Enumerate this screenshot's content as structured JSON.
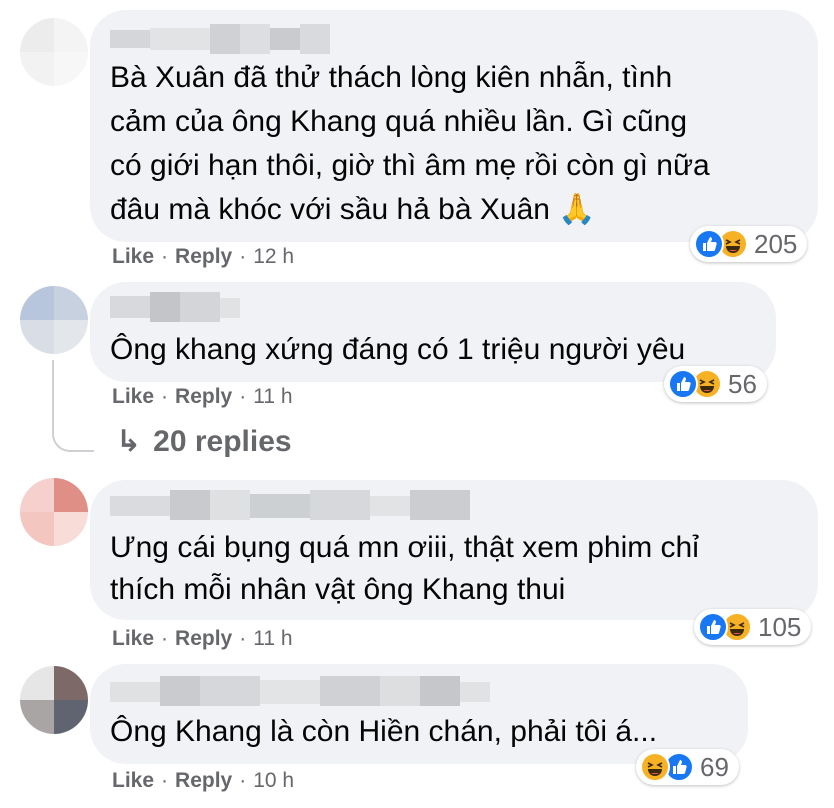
{
  "colors": {
    "bubble": "#f0f2f5",
    "meta_text": "#65676b",
    "like_blue": "#1877f2",
    "haha_yellow": "#f7b125"
  },
  "comments": [
    {
      "text_lines": [
        "Bà Xuân đã thử thách lòng kiên nhẫn, tình",
        "cảm của ông Khang quá nhiều lần. Gì cũng",
        "có giới hạn thôi, giờ thì âm mẹ rồi còn gì nữa",
        "đâu mà khóc với sầu hả bà Xuân 🙏"
      ],
      "like": "Like",
      "reply": "Reply",
      "time": "12 h",
      "reaction_icons": [
        "like-icon",
        "haha-icon"
      ],
      "reaction_count": "205"
    },
    {
      "text_lines": [
        "Ông khang xứng đáng có 1 triệu người yêu"
      ],
      "like": "Like",
      "reply": "Reply",
      "time": "11 h",
      "reaction_icons": [
        "like-icon",
        "haha-icon"
      ],
      "reaction_count": "56",
      "replies_label": "20 replies"
    },
    {
      "text_lines": [
        "Ưng cái bụng quá mn ơiii, thật xem phim chỉ",
        "thích mỗi nhân vật ông Khang thui"
      ],
      "like": "Like",
      "reply": "Reply",
      "time": "11 h",
      "reaction_icons": [
        "like-icon",
        "haha-icon"
      ],
      "reaction_count": "105"
    },
    {
      "text_lines": [
        "Ông Khang là còn Hiền chán, phải tôi á..."
      ],
      "like": "Like",
      "reply": "Reply",
      "time": "10 h",
      "reaction_icons": [
        "haha-icon",
        "like-icon"
      ],
      "reaction_count": "69"
    }
  ],
  "separator": "·",
  "replies_arrow": "↳"
}
